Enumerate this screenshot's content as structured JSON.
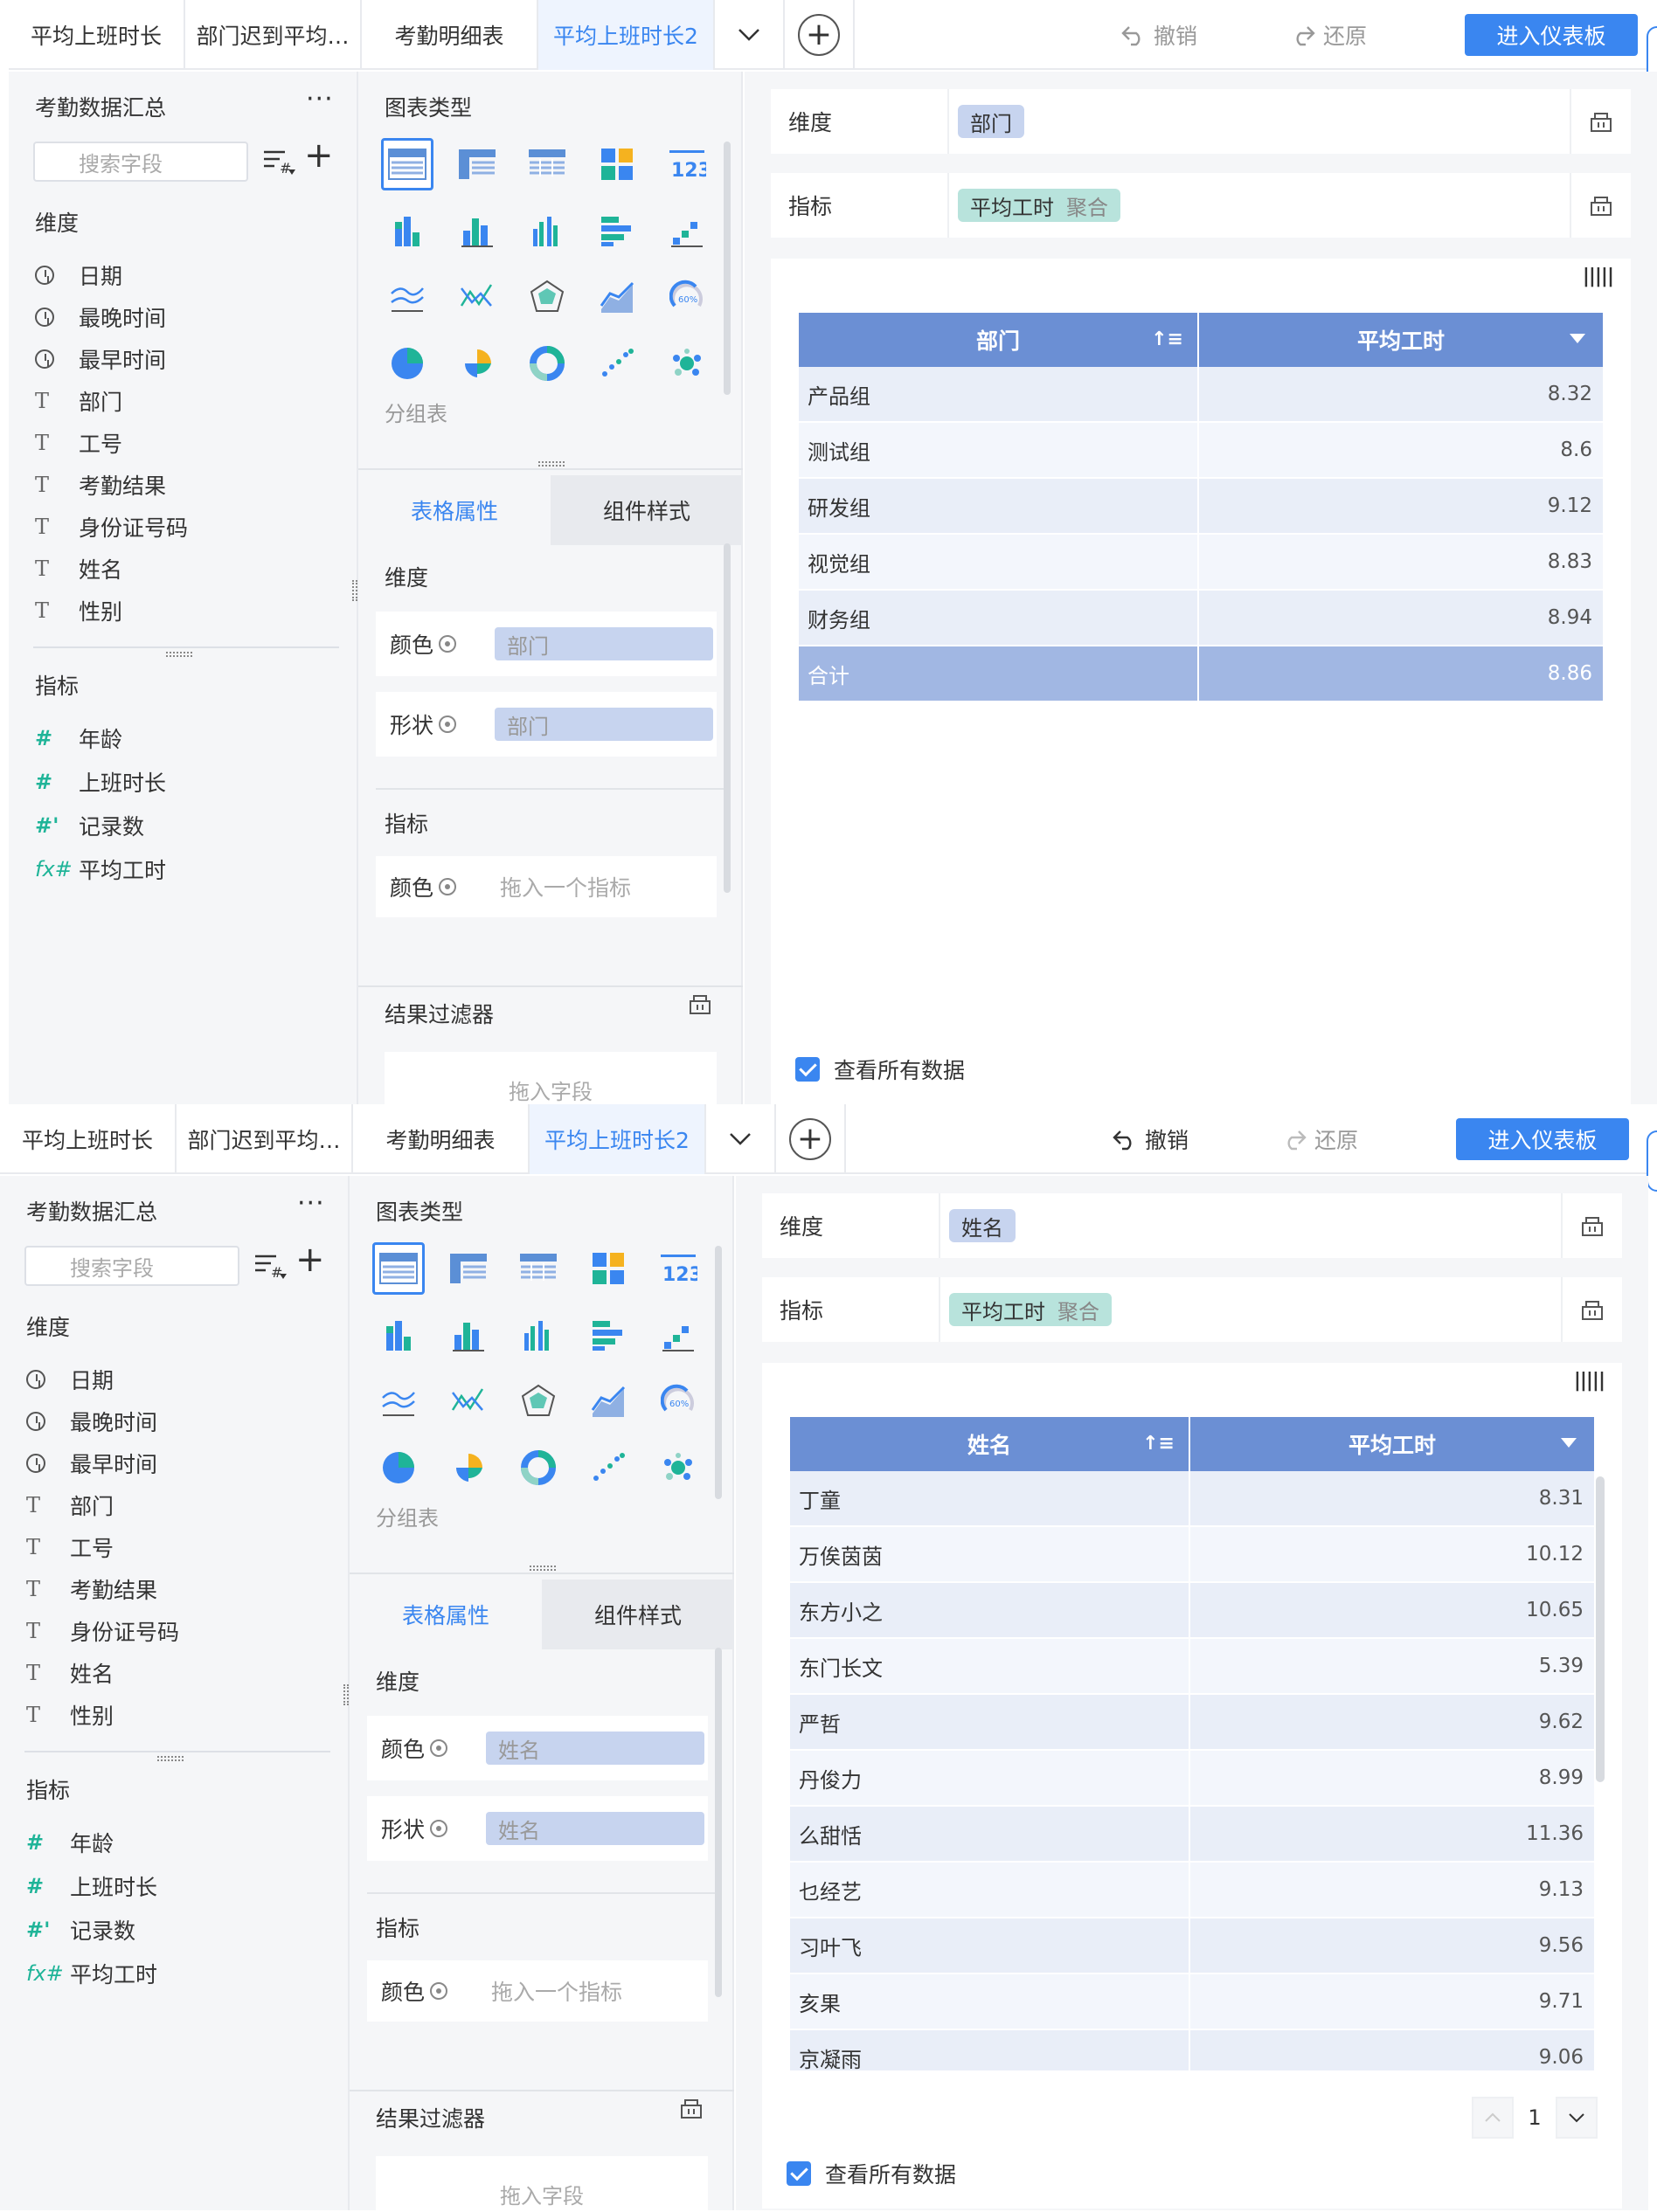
{
  "tabs": [
    "平均上班时长",
    "部门迟到平均…",
    "考勤明细表",
    "平均上班时长2"
  ],
  "actions": {
    "undo": "撤销",
    "redo": "还原",
    "enter": "进入仪表板"
  },
  "left": {
    "title": "考勤数据汇总",
    "more": "···",
    "search_placeholder": "搜索字段",
    "dim_label": "维度",
    "dims": [
      {
        "icon": "clock-icon",
        "name": "日期"
      },
      {
        "icon": "clock-icon",
        "name": "最晚时间"
      },
      {
        "icon": "clock-icon",
        "name": "最早时间"
      },
      {
        "icon": "text-type-icon",
        "name": "部门"
      },
      {
        "icon": "text-type-icon",
        "name": "工号"
      },
      {
        "icon": "text-type-icon",
        "name": "考勤结果"
      },
      {
        "icon": "text-type-icon",
        "name": "身份证号码"
      },
      {
        "icon": "text-type-icon",
        "name": "姓名"
      },
      {
        "icon": "text-type-icon",
        "name": "性别"
      }
    ],
    "meas_label": "指标",
    "measures": [
      {
        "icon": "number-type-icon",
        "name": "年龄"
      },
      {
        "icon": "number-type-icon",
        "name": "上班时长"
      },
      {
        "icon": "record-count-icon",
        "name": "记录数"
      },
      {
        "icon": "formula-icon",
        "name": "平均工时"
      }
    ]
  },
  "middle": {
    "chart_type_title": "图表类型",
    "group_table": "分组表",
    "prop_tab_active": "表格属性",
    "prop_tab_other": "组件样式",
    "dim_label": "维度",
    "color_label": "颜色",
    "shape_label": "形状",
    "meas_label": "指标",
    "drop_meas": "拖入一个指标",
    "filter_title": "结果过滤器",
    "drop_field": "拖入字段"
  },
  "panels": [
    {
      "dimension_pill": "部门",
      "measure_pill": "平均工时",
      "agg": "聚合",
      "shelf_dim_label": "维度",
      "shelf_meas_label": "指标",
      "col1": "部门",
      "col2": "平均工时",
      "rows": [
        [
          "产品组",
          "8.32"
        ],
        [
          "测试组",
          "8.6"
        ],
        [
          "研发组",
          "9.12"
        ],
        [
          "视觉组",
          "8.83"
        ],
        [
          "财务组",
          "8.94"
        ]
      ],
      "total": [
        "合计",
        "8.86"
      ],
      "view_all": "查看所有数据"
    },
    {
      "dimension_pill": "姓名",
      "measure_pill": "平均工时",
      "agg": "聚合",
      "shelf_dim_label": "维度",
      "shelf_meas_label": "指标",
      "col1": "姓名",
      "col2": "平均工时",
      "rows": [
        [
          "丁童",
          "8.31"
        ],
        [
          "万俟茵茵",
          "10.12"
        ],
        [
          "东方小之",
          "10.65"
        ],
        [
          "东门长文",
          "5.39"
        ],
        [
          "严哲",
          "9.62"
        ],
        [
          "丹俊力",
          "8.99"
        ],
        [
          "么甜恬",
          "11.36"
        ],
        [
          "乜经艺",
          "9.13"
        ],
        [
          "习叶飞",
          "9.56"
        ],
        [
          "亥果",
          "9.71"
        ],
        [
          "京凝雨",
          "9.06"
        ]
      ],
      "page": "1",
      "view_all": "查看所有数据"
    }
  ],
  "colors": {
    "accent": "#3a86f0",
    "header": "#6b8fd4",
    "dim_pill": "#c7d4ef",
    "meas_pill": "#b8e3dc",
    "teal": "#1fb498"
  }
}
